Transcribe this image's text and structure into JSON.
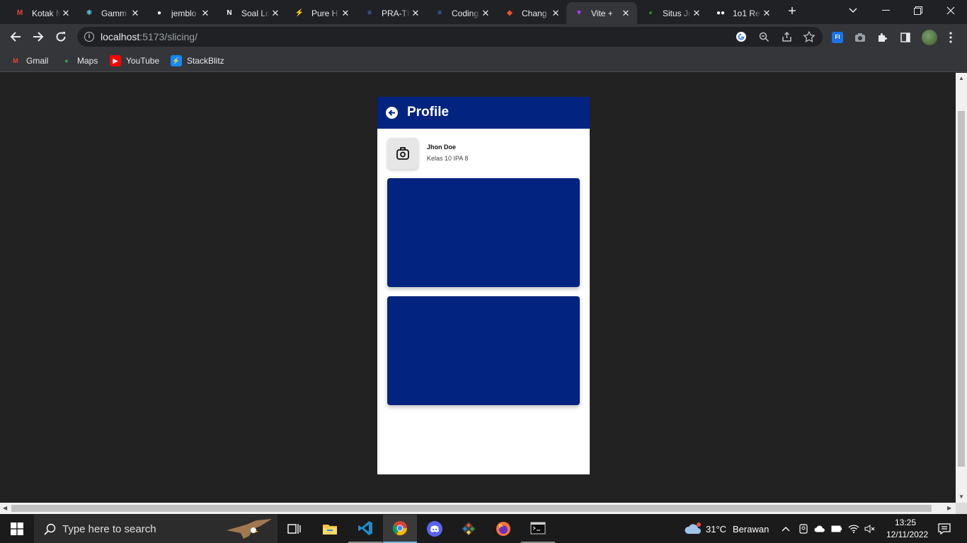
{
  "browser": {
    "tabs": [
      {
        "title": "Kotak M",
        "icon": "gmail-icon",
        "color": "#ea4335",
        "glyph": "M"
      },
      {
        "title": "Gamm",
        "icon": "react-icon",
        "color": "#61dafb",
        "glyph": "⚛"
      },
      {
        "title": "jemblo",
        "icon": "github-icon",
        "color": "#ffffff",
        "glyph": "●"
      },
      {
        "title": "Soal Lo",
        "icon": "notion-icon",
        "color": "#ffffff",
        "glyph": "N"
      },
      {
        "title": "Pure H",
        "icon": "stackblitz-icon",
        "color": "#1389fd",
        "glyph": "⚡"
      },
      {
        "title": "PRA-TI",
        "icon": "docs-icon",
        "color": "#4285f4",
        "glyph": "≡"
      },
      {
        "title": "Coding",
        "icon": "docs-icon",
        "color": "#4285f4",
        "glyph": "≡"
      },
      {
        "title": "Chang",
        "icon": "figma-icon",
        "color": "#f24e1e",
        "glyph": "◆"
      },
      {
        "title": "Vite +",
        "icon": "vite-icon",
        "color": "#bd34fe",
        "glyph": "▼"
      },
      {
        "title": "Situs Ju",
        "icon": "frog-icon",
        "color": "#2e7d32",
        "glyph": "●"
      },
      {
        "title": "1o1 Re",
        "icon": "medium-icon",
        "color": "#ffffff",
        "glyph": "●●"
      }
    ],
    "active_tab": 8,
    "new_tab_label": "+",
    "url_host": "localhost",
    "url_path": ":5173/slicing/",
    "bookmarks": [
      {
        "label": "Gmail",
        "icon": "gmail-icon",
        "color": "#ea4335",
        "glyph": "M"
      },
      {
        "label": "Maps",
        "icon": "maps-pin-icon",
        "color": "#34a853",
        "glyph": "●"
      },
      {
        "label": "YouTube",
        "icon": "youtube-icon",
        "color": "#ff0000",
        "glyph": "▶"
      },
      {
        "label": "StackBlitz",
        "icon": "stackblitz-icon",
        "color": "#1389fd",
        "glyph": "⚡"
      }
    ]
  },
  "app": {
    "title": "Profile",
    "brand_color": "#022480",
    "user_name": "Jhon Doe",
    "user_class": "Kelas 10 IPA 8"
  },
  "taskbar": {
    "search_placeholder": "Type here to search",
    "weather_temp": "31°C",
    "weather_desc": "Berawan",
    "time": "13:25",
    "date": "12/11/2022"
  }
}
